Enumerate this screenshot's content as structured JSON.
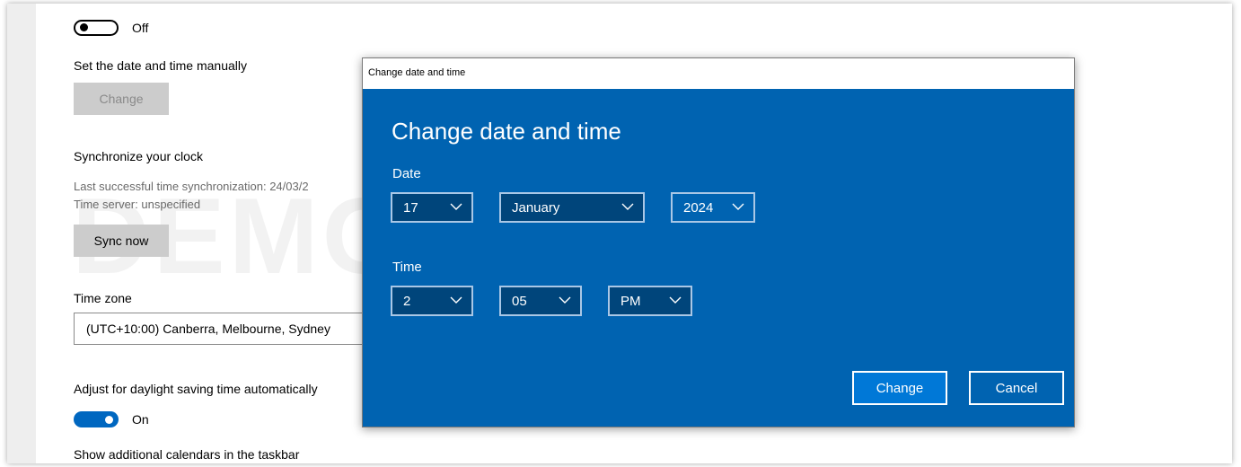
{
  "settings": {
    "sync_toggle_state": "Off",
    "manual_label": "Set the date and time manually",
    "change_label": "Change",
    "sync_heading": "Synchronize your clock",
    "last_sync": "Last successful time synchronization: 24/03/2",
    "time_server": "Time server: unspecified",
    "sync_now_label": "Sync now",
    "timezone_label": "Time zone",
    "timezone_value": "(UTC+10:00) Canberra, Melbourne, Sydney",
    "dst_label": "Adjust for daylight saving time automatically",
    "dst_toggle_state": "On",
    "calendars_label": "Show additional calendars in the taskbar"
  },
  "watermark": "DEMO VERSION",
  "dialog": {
    "window_title": "Change date and time",
    "heading": "Change date and time",
    "date_label": "Date",
    "day": "17",
    "month": "January",
    "year": "2024",
    "time_label": "Time",
    "hour": "2",
    "minute": "05",
    "ampm": "PM",
    "change_label": "Change",
    "cancel_label": "Cancel"
  },
  "colors": {
    "accent": "#0063b1",
    "toggle_on": "#0067c0"
  }
}
